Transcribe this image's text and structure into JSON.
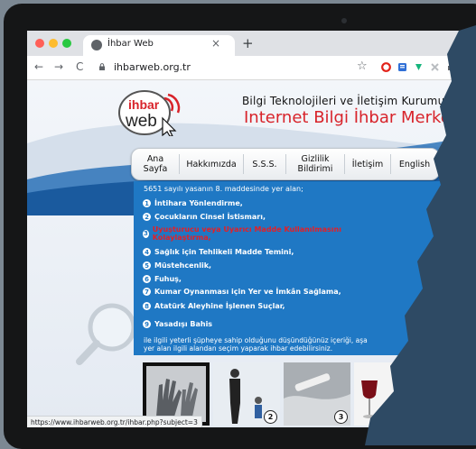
{
  "browser": {
    "tab_title": "İhbar Web",
    "tab_close": "×",
    "new_tab": "+",
    "back": "←",
    "forward": "→",
    "reload": "C",
    "url": "ihbarweb.org.tr",
    "star": "☆",
    "status_url": "https://www.ihbarweb.org.tr/ihbar.php?subject=3"
  },
  "site": {
    "logo_text_top": "ihbar",
    "logo_text_bottom": "web",
    "org_name": "Bilgi Teknolojileri ve İletişim Kurumu",
    "site_name": "Internet Bilgi İhbar Merkezi"
  },
  "menu": [
    {
      "label": "Ana\nSayfa"
    },
    {
      "label": "Hakkımızda"
    },
    {
      "label": "S.S.S."
    },
    {
      "label": "Gizlilik\nBildirimi"
    },
    {
      "label": "İletişim"
    },
    {
      "label": "English"
    }
  ],
  "content": {
    "intro": "5651 sayılı yasanın 8. maddesinde yer alan;",
    "items": [
      {
        "n": "1",
        "label": "İntihara Yönlendirme,",
        "highlight": false
      },
      {
        "n": "2",
        "label": "Çocukların Cinsel İstismarı,",
        "highlight": false
      },
      {
        "n": "3",
        "label": "Uyuşturucu veya Uyarıcı Madde Kullanılmasını Kolaylaştırma,",
        "highlight": true
      },
      {
        "n": "4",
        "label": "Sağlık için Tehlikeli Madde Temini,",
        "highlight": false
      },
      {
        "n": "5",
        "label": "Müstehcenlik,",
        "highlight": false
      },
      {
        "n": "6",
        "label": "Fuhuş,",
        "highlight": false
      },
      {
        "n": "7",
        "label": "Kumar Oynanması için Yer ve İmkân Sağlama,",
        "highlight": false
      },
      {
        "n": "8",
        "label": "Atatürk Aleyhine İşlenen Suçlar,",
        "highlight": false
      },
      {
        "n": "9",
        "label": "Yasadışı Bahis",
        "highlight": false
      }
    ],
    "footer_line1": "ile ilgili yeterli şüpheye sahip olduğunu düşündüğünüz içeriği, aşa",
    "footer_line2": "yer alan ilgili alandan seçim yaparak ihbar edebilirsiniz."
  },
  "thumbnails": [
    {
      "n": ""
    },
    {
      "n": "2"
    },
    {
      "n": "3"
    },
    {
      "n": ""
    }
  ],
  "colors": {
    "accent_red": "#d8232a",
    "content_blue": "#1f78c4",
    "overlay_navy": "#2e4a64"
  }
}
